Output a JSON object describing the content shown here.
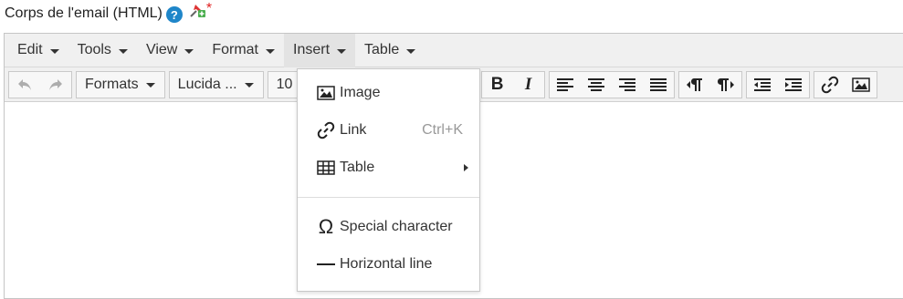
{
  "field": {
    "label": "Corps de l'email (HTML)",
    "help_glyph": "?",
    "required_mark": "*"
  },
  "menubar": {
    "items": [
      {
        "label": "Edit"
      },
      {
        "label": "Tools"
      },
      {
        "label": "View"
      },
      {
        "label": "Format"
      },
      {
        "label": "Insert"
      },
      {
        "label": "Table"
      }
    ]
  },
  "toolbar": {
    "formats_label": "Formats",
    "font_family_label": "Lucida ...",
    "font_size_label": "10",
    "icons": [
      "undo-icon",
      "redo-icon",
      "bold-icon",
      "italic-icon",
      "align-left-icon",
      "align-center-icon",
      "align-right-icon",
      "align-justify-icon",
      "ltr-icon",
      "rtl-icon",
      "outdent-icon",
      "indent-icon",
      "link-icon",
      "image-icon"
    ]
  },
  "insert_menu": {
    "items": [
      {
        "label": "Image",
        "icon": "image-icon"
      },
      {
        "label": "Link",
        "shortcut": "Ctrl+K",
        "icon": "link-icon"
      },
      {
        "label": "Table",
        "icon": "table-icon",
        "submenu": true
      },
      {
        "label": "Special character",
        "icon": "omega-icon"
      },
      {
        "label": "Horizontal line",
        "icon": "horizontal-line-icon"
      }
    ]
  },
  "colors": {
    "help_icon": "#1f86c9",
    "required": "#e02020",
    "menubar_bg": "#f0f0f0"
  }
}
